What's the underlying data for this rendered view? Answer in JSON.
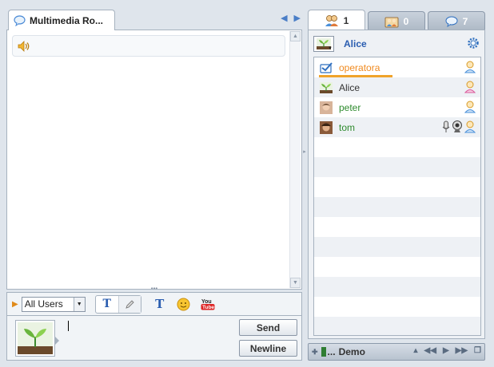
{
  "room": {
    "tab_title": "Multimedia Ro..."
  },
  "toolbar": {
    "recipient": "All Users",
    "format_label": "T",
    "color_label": "T"
  },
  "compose": {
    "message": "",
    "send_label": "Send",
    "newline_label": "Newline"
  },
  "right_tabs": [
    {
      "count": "1",
      "icon": "users-icon"
    },
    {
      "count": "0",
      "icon": "rooms-icon"
    },
    {
      "count": "7",
      "icon": "chat-bubble-icon"
    }
  ],
  "me": {
    "name": "Alice"
  },
  "users": [
    {
      "name": "operatora",
      "color": "#f08a1f",
      "icon": "person-icon"
    },
    {
      "name": "Alice",
      "color": "#333333",
      "icon": "person-pink-icon"
    },
    {
      "name": "peter",
      "color": "#2e8b2e",
      "icon": "person-icon"
    },
    {
      "name": "tom",
      "color": "#2e8b2e",
      "icon": "person-icon"
    }
  ],
  "bottom": {
    "room_label": "Demo"
  },
  "colors": {
    "accent": "#2a5db0",
    "operator": "#f08a1f",
    "border": "#a6b2bf"
  }
}
